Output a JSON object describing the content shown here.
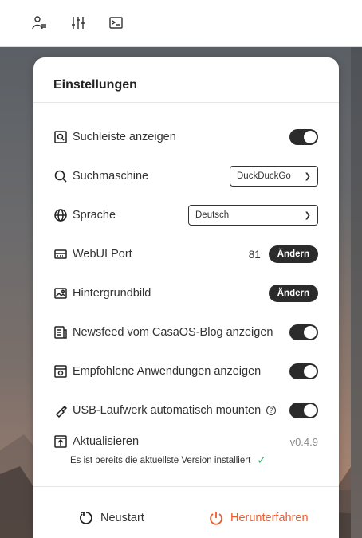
{
  "topbar": {
    "icons": [
      "user-icon",
      "sliders-icon",
      "terminal-icon"
    ]
  },
  "panel": {
    "title": "Einstellungen",
    "rows": [
      {
        "id": "search-bar",
        "label": "Suchleiste anzeigen",
        "icon": "searchbar-icon",
        "control": "toggle",
        "enabled": true
      },
      {
        "id": "search-engine",
        "label": "Suchmaschine",
        "icon": "search-icon",
        "control": "select",
        "value": "DuckDuckGo"
      },
      {
        "id": "language",
        "label": "Sprache",
        "icon": "globe-icon",
        "control": "select",
        "value": "Deutsch"
      },
      {
        "id": "webui-port",
        "label": "WebUI Port",
        "icon": "port-icon",
        "control": "button",
        "value": "81",
        "button": "Ändern"
      },
      {
        "id": "wallpaper",
        "label": "Hintergrundbild",
        "icon": "image-icon",
        "control": "button",
        "button": "Ändern"
      },
      {
        "id": "newsfeed",
        "label": "Newsfeed vom CasaOS-Blog anzeigen",
        "icon": "news-icon",
        "control": "toggle",
        "enabled": true
      },
      {
        "id": "recommended-apps",
        "label": "Empfohlene Anwendungen anzeigen",
        "icon": "apps-icon",
        "control": "toggle",
        "enabled": true
      },
      {
        "id": "usb-automount",
        "label": "USB-Laufwerk automatisch mounten",
        "icon": "usb-icon",
        "control": "toggle",
        "enabled": true,
        "info": "?"
      }
    ],
    "update": {
      "label": "Aktualisieren",
      "version": "v0.4.9",
      "note": "Es ist bereits die aktuellste Version installiert",
      "check": "✓"
    },
    "footer": {
      "restart": "Neustart",
      "shutdown": "Herunterfahren"
    }
  },
  "colors": {
    "accent_dark": "#2b2b2b",
    "shutdown": "#f05a28",
    "success": "#35b26b",
    "version_gray": "#8a8a8a"
  }
}
